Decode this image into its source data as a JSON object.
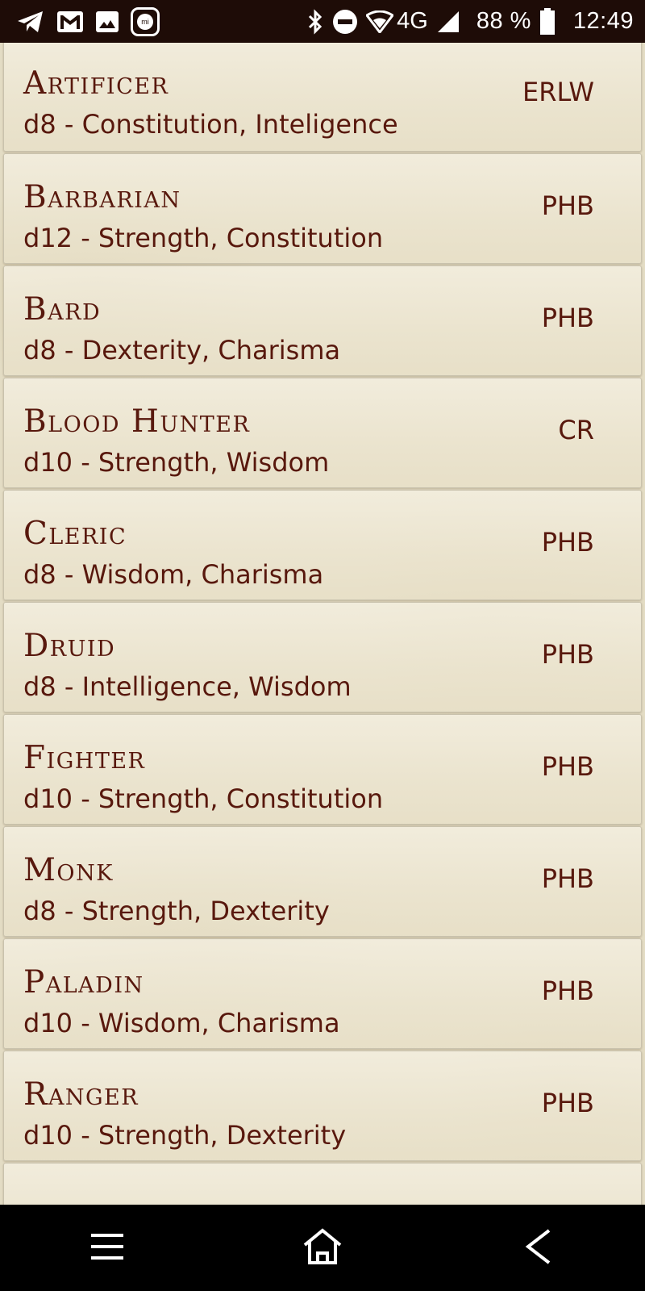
{
  "status_bar": {
    "icons_left": [
      "telegram-icon",
      "gmail-icon",
      "gallery-icon",
      "mi-icon"
    ],
    "mi_label": "mi",
    "icons_right": [
      "bluetooth-icon",
      "do-not-disturb-icon",
      "wifi-icon",
      "cell-signal-icon",
      "battery-icon"
    ],
    "network": "4G",
    "battery": "88 %",
    "time": "12:49"
  },
  "classes": [
    {
      "name": "Artificer",
      "detail": "d8 - Constitution, Inteligence",
      "source": "ERLW"
    },
    {
      "name": "Barbarian",
      "detail": "d12 - Strength, Constitution",
      "source": "PHB"
    },
    {
      "name": "Bard",
      "detail": "d8 - Dexterity, Charisma",
      "source": "PHB"
    },
    {
      "name": "Blood Hunter",
      "detail": "d10 - Strength, Wisdom",
      "source": "CR"
    },
    {
      "name": "Cleric",
      "detail": "d8 - Wisdom, Charisma",
      "source": "PHB"
    },
    {
      "name": "Druid",
      "detail": "d8 - Intelligence, Wisdom",
      "source": "PHB"
    },
    {
      "name": "Fighter",
      "detail": "d10 - Strength, Constitution",
      "source": "PHB"
    },
    {
      "name": "Monk",
      "detail": "d8 - Strength, Dexterity",
      "source": "PHB"
    },
    {
      "name": "Paladin",
      "detail": "d10 - Wisdom, Charisma",
      "source": "PHB"
    },
    {
      "name": "Ranger",
      "detail": "d10 - Strength, Dexterity",
      "source": "PHB"
    }
  ],
  "nav_bar": {
    "buttons": [
      "menu-icon",
      "home-icon",
      "back-icon"
    ]
  },
  "colors": {
    "status_bar_bg": "#1e0c07",
    "text_accent": "#58180d",
    "parchment": "#e3dcc4"
  }
}
